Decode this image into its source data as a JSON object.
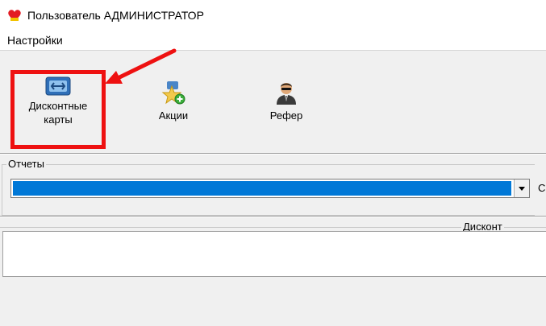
{
  "window": {
    "title": "Пользователь АДМИНИСТРАТОР",
    "icon": "heart-app-icon"
  },
  "menu": {
    "items": [
      {
        "label": "Настройки"
      }
    ]
  },
  "toolbar": {
    "items": [
      {
        "label_line1": "Дисконтные",
        "label_line2": "карты",
        "icon": "discount-card-icon"
      },
      {
        "label": "Акции",
        "icon": "star-add-icon"
      },
      {
        "label": "Рефер",
        "icon": "agent-person-icon"
      }
    ]
  },
  "reports": {
    "group_label": "Отчеты",
    "cut_label": "С"
  },
  "discount": {
    "label": "Дисконт"
  },
  "colors": {
    "highlight": "#ee1111",
    "selection": "#0078d7"
  }
}
